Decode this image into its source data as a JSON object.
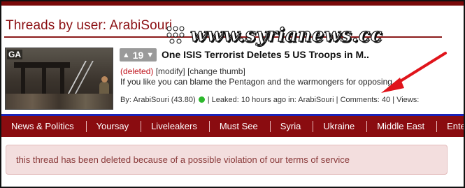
{
  "page": {
    "title": "Threads by user: ArabiSouri",
    "watermark": "www.syrianews.cc"
  },
  "thread": {
    "thumb_badge": "GA",
    "vote_count": "19",
    "vote_up_icon": "chevron-up-icon",
    "vote_down_icon": "chevron-down-icon",
    "title": "One ISIS Terrorist Deletes 5 US Troops in M..",
    "actions": {
      "deleted": "(deleted)",
      "modify": "[modify]",
      "change_thumb": "[change thumb]"
    },
    "description": "If you like you can blame the Pentagon and the warmongers for opposing.",
    "meta": {
      "by_label": "By:",
      "author": "ArabiSouri",
      "score": "(43.80)",
      "status_color": "#2db82d",
      "leaked": "| Leaked: 10 hours ago in:",
      "category": "ArabiSouri",
      "comments_label": "| Comments:",
      "comments": "40",
      "views_label": "| Views:"
    }
  },
  "nav": {
    "items": [
      "News & Politics",
      "Yoursay",
      "Liveleakers",
      "Must See",
      "Syria",
      "Ukraine",
      "Middle East",
      "Entertainment"
    ]
  },
  "alert": {
    "message": "this thread has been deleted because of a possible violation of our terms of service"
  },
  "colors": {
    "brand_red": "#8a0c10",
    "title_red": "#8b0f12",
    "deleted_red": "#c0171f",
    "nav_blue_line": "#1a23b8",
    "alert_bg": "#f3dede",
    "arrow_red": "#e0141b"
  }
}
